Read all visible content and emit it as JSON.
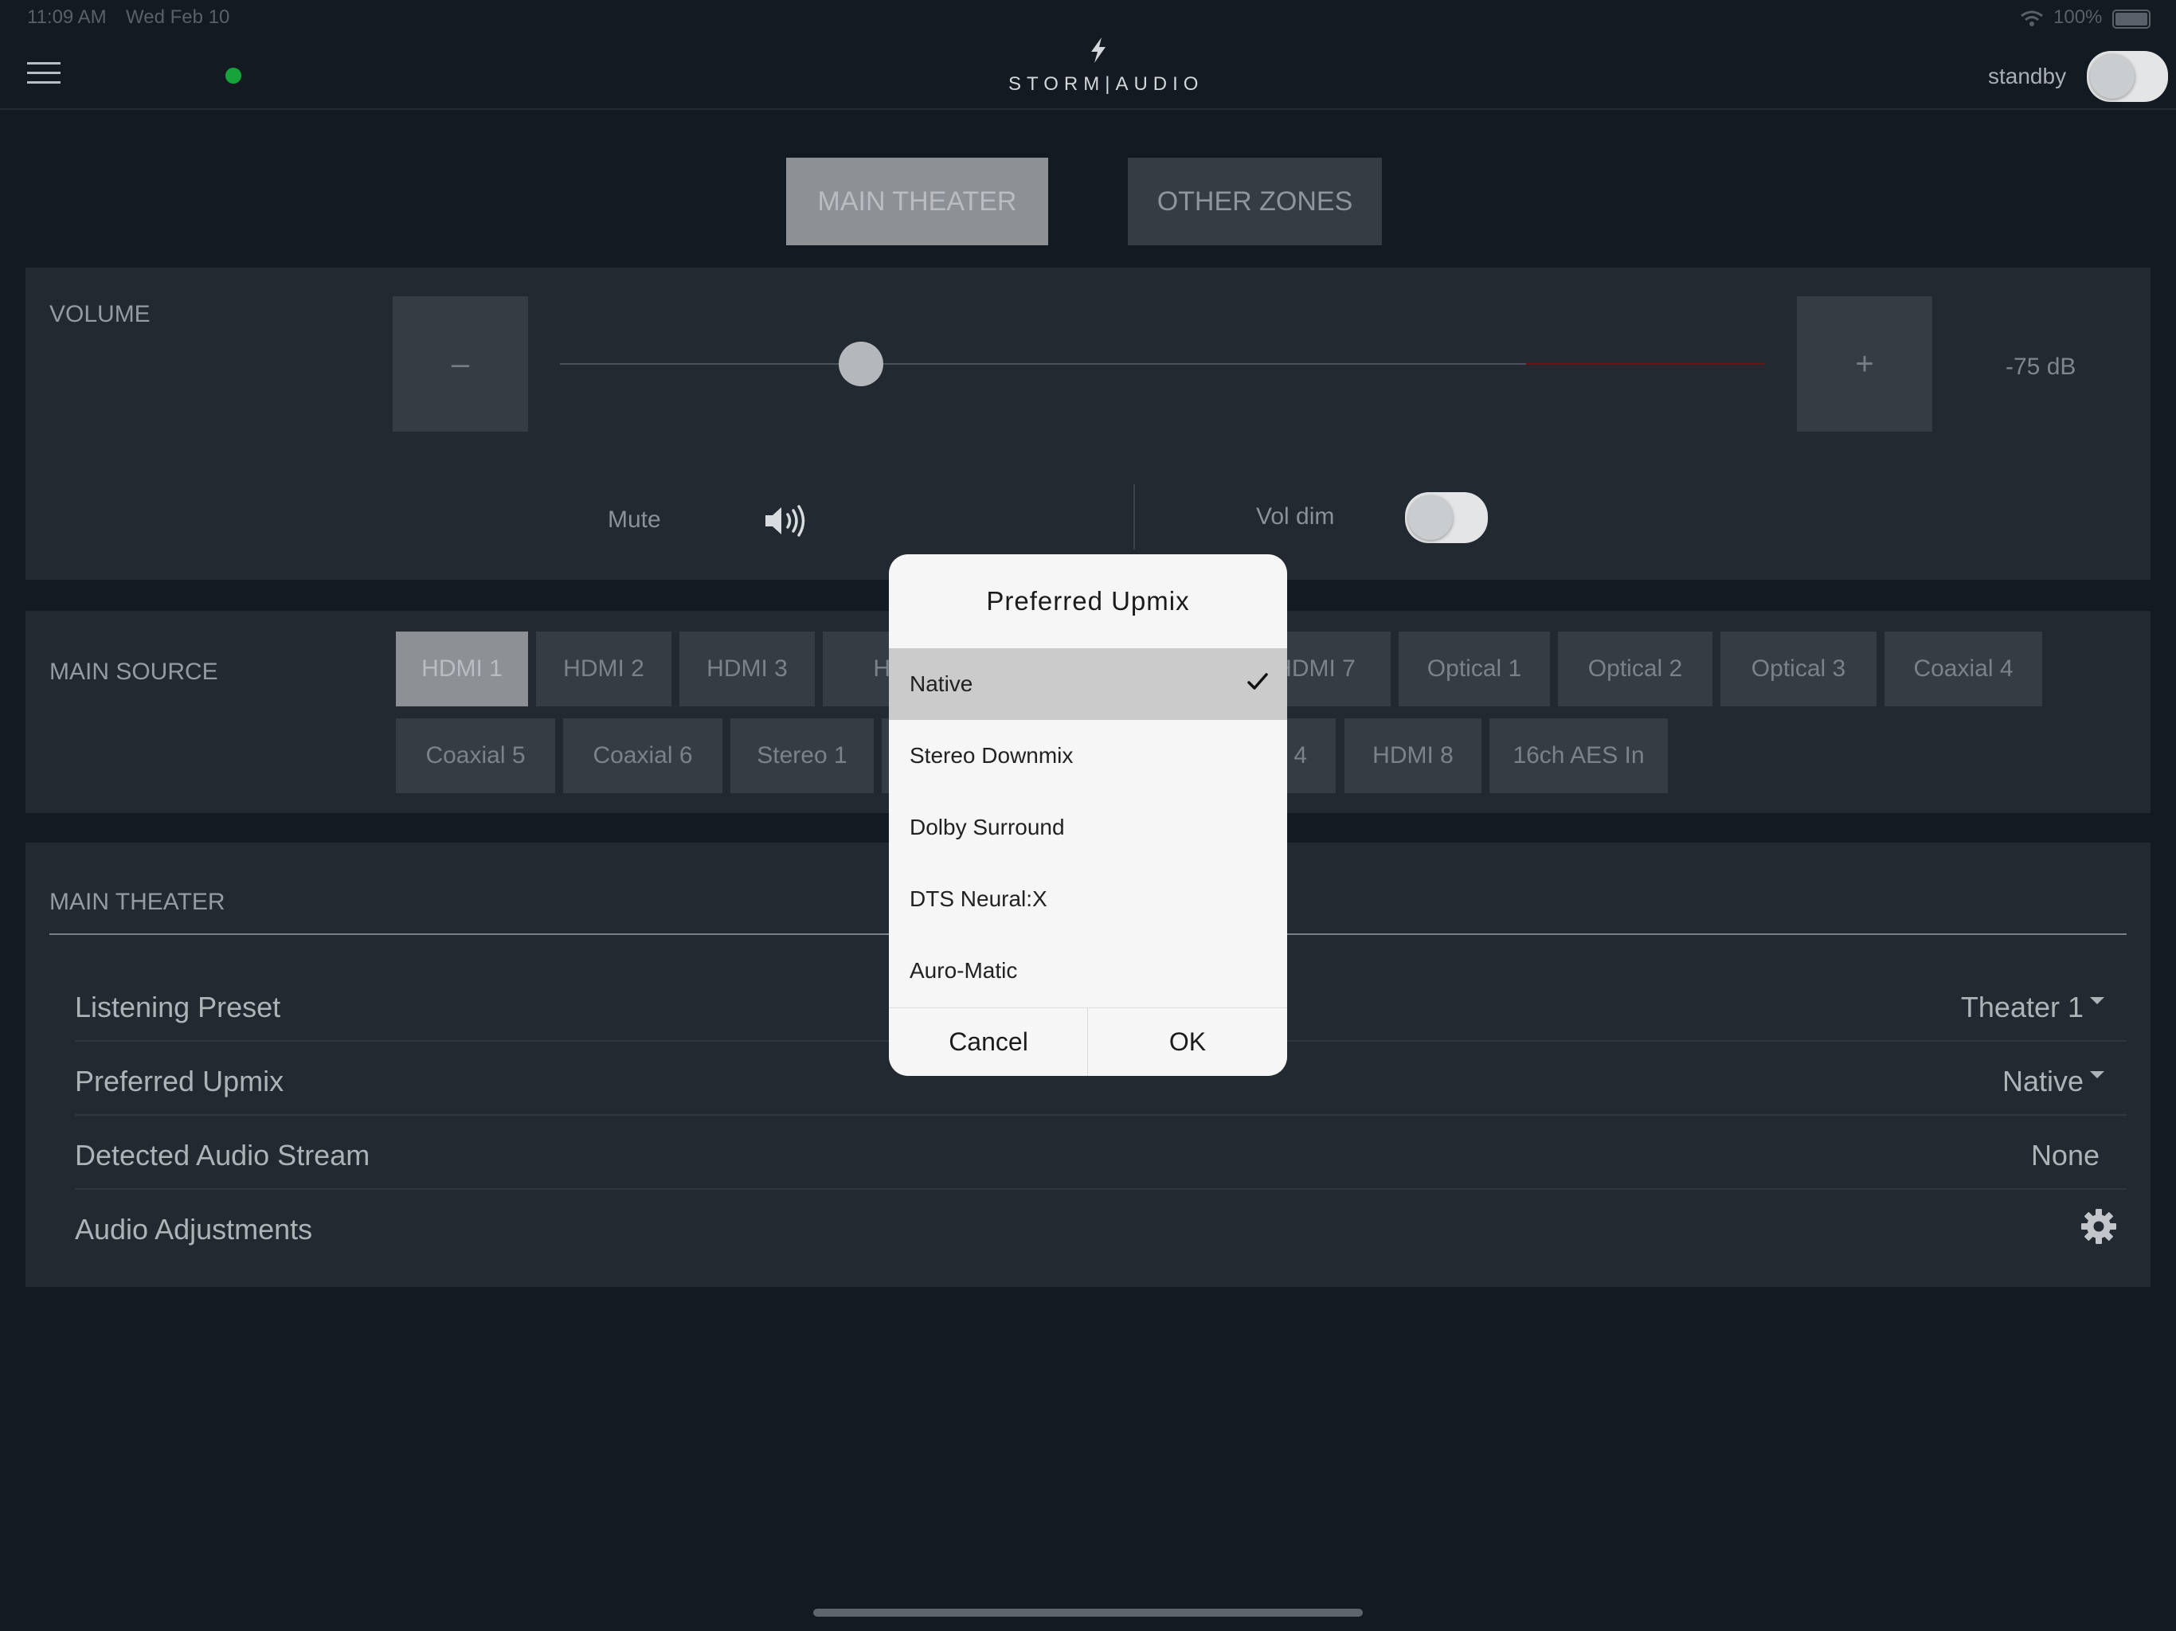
{
  "status_bar": {
    "time": "11:09 AM",
    "date": "Wed Feb 10",
    "battery": "100%"
  },
  "header": {
    "logo": "STORM|AUDIO",
    "standby_label": "standby"
  },
  "zones": {
    "main_theater": "MAIN THEATER",
    "other_zones": "OTHER ZONES"
  },
  "volume": {
    "label": "VOLUME",
    "minus": "–",
    "plus": "+",
    "db": "-75 dB",
    "level": 0.25,
    "mute_label": "Mute",
    "vol_dim_label": "Vol dim"
  },
  "main_source": {
    "label": "MAIN SOURCE",
    "row1": [
      "HDMI 1",
      "HDMI 2",
      "HDMI 3",
      "HD",
      "HDMI 7",
      "Optical 1",
      "Optical 2",
      "Optical 3",
      "Coaxial 4"
    ],
    "row2": [
      "Coaxial 5",
      "Coaxial 6",
      "Stereo 1",
      "4",
      "HDMI 8",
      "16ch AES In"
    ],
    "selected": "HDMI 1"
  },
  "main_theater": {
    "label": "MAIN THEATER",
    "rows": [
      {
        "label": "Listening Preset",
        "value": "Theater 1"
      },
      {
        "label": "Preferred Upmix",
        "value": "Native"
      },
      {
        "label": "Detected Audio Stream",
        "value": "None"
      },
      {
        "label": "Audio Adjustments",
        "value": ""
      }
    ]
  },
  "modal": {
    "title": "Preferred Upmix",
    "options": [
      "Native",
      "Stereo Downmix",
      "Dolby Surround",
      "DTS Neural:X",
      "Auro-Matic"
    ],
    "selected": "Native",
    "cancel": "Cancel",
    "ok": "OK"
  },
  "icons": {
    "menu": "hamburger-icon",
    "connection": "status-dot-icon",
    "logo": "lightning-bolt-icon",
    "mute": "speaker-icon",
    "adjustments": "gear-icon",
    "selected": "checkmark-icon",
    "dropdown": "caret-down-icon"
  },
  "colors": {
    "connected": "#18a33a",
    "volume_limit": "#6e1114"
  }
}
